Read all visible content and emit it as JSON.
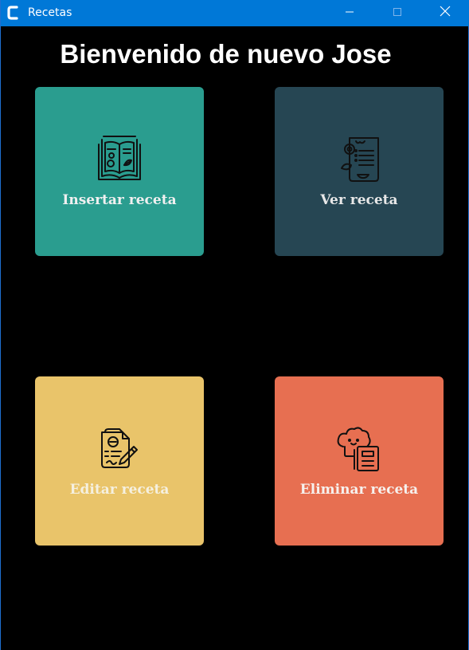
{
  "window": {
    "title": "Recetas",
    "titlebar_color": "#0078d7",
    "app_icon": "app-c-icon",
    "controls": [
      "minimize-icon",
      "maximize-icon",
      "close-icon"
    ]
  },
  "heading": "Bienvenido de nuevo Jose",
  "cards": [
    {
      "label": "Insertar receta",
      "icon": "recipe-book-icon",
      "color": "#2a9d8f"
    },
    {
      "label": "Ver receta",
      "icon": "recipe-list-icon",
      "color": "#264653"
    },
    {
      "label": "Editar receta",
      "icon": "edit-recipe-icon",
      "color": "#e9c46a"
    },
    {
      "label": "Eliminar receta",
      "icon": "chef-recipe-icon",
      "color": "#e76f51"
    }
  ]
}
